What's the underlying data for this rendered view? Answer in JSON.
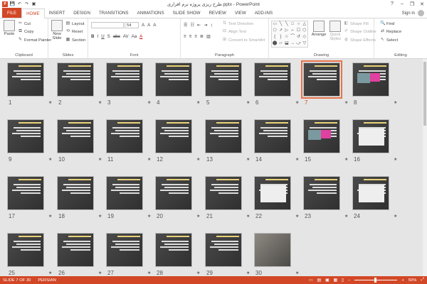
{
  "window": {
    "title": "طرح ریزی پروژه نرم افزاری.pptx - PowerPoint",
    "help": "?",
    "minimize": "–",
    "restore": "❐",
    "close": "✕"
  },
  "qat": {
    "app": "P",
    "save": "💾",
    "undo": "↶",
    "redo": "↷",
    "present": "▣"
  },
  "tabs": [
    "FILE",
    "HOME",
    "INSERT",
    "DESIGN",
    "TRANSITIONS",
    "ANIMATIONS",
    "SLIDE SHOW",
    "REVIEW",
    "VIEW",
    "ADD-INS"
  ],
  "active_tab": "HOME",
  "account": {
    "label": "Sign in"
  },
  "ribbon": {
    "clipboard": {
      "label": "Clipboard",
      "paste": "Paste",
      "cut": "Cut",
      "copy": "Copy",
      "format_painter": "Format Painter"
    },
    "slides": {
      "label": "Slides",
      "new_slide": "New Slide",
      "layout": "Layout",
      "reset": "Reset",
      "section": "Section"
    },
    "font": {
      "label": "Font",
      "size": "54",
      "grow": "A",
      "shrink": "A",
      "clear": "A",
      "bold": "B",
      "italic": "I",
      "underline": "U",
      "shadow": "S",
      "strike": "abc",
      "spacing": "AV",
      "case": "Aa",
      "color": "A"
    },
    "paragraph": {
      "label": "Paragraph",
      "text_direction": "Text Direction",
      "align_text": "Align Text",
      "convert": "Convert to SmartArt"
    },
    "drawing": {
      "label": "Drawing",
      "arrange": "Arrange",
      "quick_styles": "Quick Styles",
      "shape_fill": "Shape Fill",
      "shape_outline": "Shape Outline",
      "shape_effects": "Shape Effects",
      "shapes": [
        "▭",
        "╲",
        "╲",
        "□",
        "○",
        "△",
        "⬠",
        "↗",
        "▷",
        "⌐",
        "☐",
        "⬡",
        "{",
        "}",
        "☆",
        "⌒",
        "↺",
        "◇",
        "⬤",
        "▱",
        "⬓",
        "→",
        "⤻",
        "▽"
      ]
    },
    "editing": {
      "label": "Editing",
      "find": "Find",
      "replace": "Replace",
      "select": "Select"
    }
  },
  "slides": [
    {
      "num": "1",
      "star": "★"
    },
    {
      "num": "2",
      "star": "★"
    },
    {
      "num": "3",
      "star": "★"
    },
    {
      "num": "4",
      "star": "★"
    },
    {
      "num": "5",
      "star": "★"
    },
    {
      "num": "6",
      "star": "★"
    },
    {
      "num": "7",
      "star": "★"
    },
    {
      "num": "8",
      "star": "★"
    },
    {
      "num": "9",
      "star": "★"
    },
    {
      "num": "10",
      "star": "★"
    },
    {
      "num": "11",
      "star": "★"
    },
    {
      "num": "12",
      "star": "★"
    },
    {
      "num": "13",
      "star": "★"
    },
    {
      "num": "14",
      "star": "★"
    },
    {
      "num": "15",
      "star": "★"
    },
    {
      "num": "16",
      "star": "★"
    },
    {
      "num": "17",
      "star": "★"
    },
    {
      "num": "18",
      "star": "★"
    },
    {
      "num": "19",
      "star": "★"
    },
    {
      "num": "20",
      "star": "★"
    },
    {
      "num": "21",
      "star": "★"
    },
    {
      "num": "22",
      "star": "★"
    },
    {
      "num": "23",
      "star": "★"
    },
    {
      "num": "24",
      "star": "★"
    },
    {
      "num": "25",
      "star": "★"
    },
    {
      "num": "26",
      "star": "★"
    },
    {
      "num": "27",
      "star": "★"
    },
    {
      "num": "28",
      "star": "★"
    },
    {
      "num": "29",
      "star": "★"
    },
    {
      "num": "30",
      "star": "★"
    }
  ],
  "selected_slide": 7,
  "status": {
    "slide": "SLIDE 7 OF 30",
    "language": "PERSIAN",
    "zoom": "50%"
  }
}
